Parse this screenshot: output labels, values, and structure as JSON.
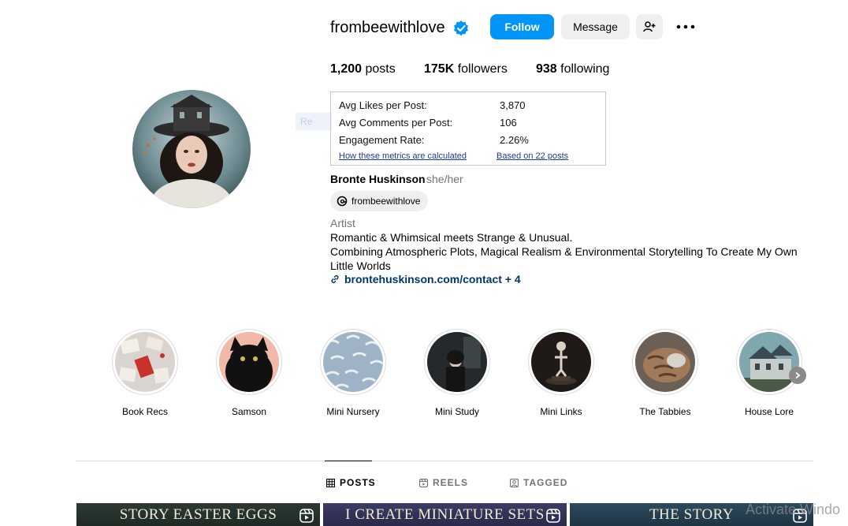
{
  "profile": {
    "username": "frombeewithlove",
    "follow_label": "Follow",
    "message_label": "Message",
    "stats": {
      "posts_count": "1,200",
      "posts_label": "posts",
      "followers_count": "175K",
      "followers_label": "followers",
      "following_count": "938",
      "following_label": "following"
    },
    "full_name": "Bronte Huskinson",
    "pronouns": "she/her",
    "threads_handle": "frombeewithlove",
    "category": "Artist",
    "bio_lines": [
      "Romantic & Whimsical meets Strange & Unusual.",
      "Combining Atmospheric Plots, Magical Realism & Environmental Storytelling To Create My Own",
      "Little Worlds"
    ],
    "link": "brontehuskinson.com/contact + 4"
  },
  "metrics": {
    "rows": [
      {
        "label": "Avg Likes per Post:",
        "value": "3,870"
      },
      {
        "label": "Avg Comments per Post:",
        "value": "106"
      },
      {
        "label": "Engagement Rate:",
        "value": "2.26%"
      }
    ],
    "how_link": "How these metrics are calculated",
    "based_link": "Based on 22 posts"
  },
  "overlay_ghost_text": "Re",
  "highlights": [
    {
      "label": "Book Recs"
    },
    {
      "label": "Samson"
    },
    {
      "label": "Mini Nursery"
    },
    {
      "label": "Mini Study"
    },
    {
      "label": "Mini Links"
    },
    {
      "label": "The Tabbies"
    },
    {
      "label": "House Lore"
    }
  ],
  "tabs": [
    {
      "label": "POSTS",
      "icon": "grid-icon",
      "active": true
    },
    {
      "label": "REELS",
      "icon": "reels-icon",
      "active": false
    },
    {
      "label": "TAGGED",
      "icon": "tagged-icon",
      "active": false
    }
  ],
  "posts": [
    {
      "title": "STORY EASTER EGGS"
    },
    {
      "title": "I CREATE MINIATURE SETS"
    },
    {
      "title": "THE STORY"
    }
  ],
  "watermark": "Activate Windo",
  "colors": {
    "accent": "#0095f6",
    "link": "#00376b",
    "verified": "#0095f6"
  }
}
